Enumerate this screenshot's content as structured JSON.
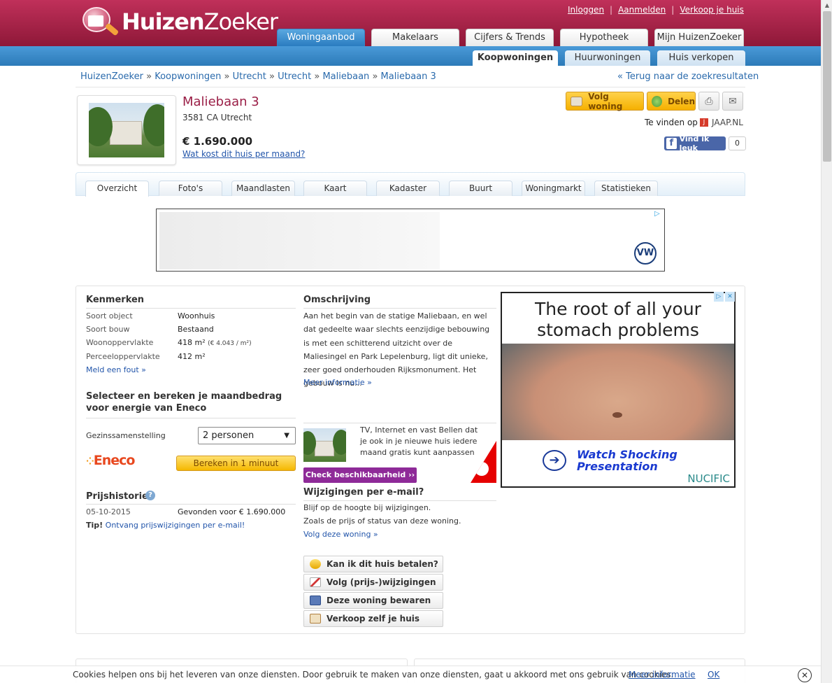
{
  "header": {
    "logo_bold": "Huizen",
    "logo_light": "Zoeker",
    "links": [
      "Inloggen",
      "Aanmelden",
      "Verkoop je huis"
    ],
    "main_tabs": [
      "Woningaanbod",
      "Makelaars",
      "Cijfers & Trends",
      "Hypotheek",
      "Mijn HuizenZoeker"
    ],
    "sub_tabs": [
      "Koopwoningen",
      "Huurwoningen",
      "Huis verkopen"
    ]
  },
  "breadcrumb": [
    "HuizenZoeker",
    "Koopwoningen",
    "Utrecht",
    "Utrecht",
    "Maliebaan",
    "Maliebaan 3"
  ],
  "breadcrumb_sep": "»",
  "back_link": "« Terug naar de zoekresultaten",
  "property": {
    "title": "Maliebaan 3",
    "address": "3581 CA Utrecht",
    "price": "€ 1.690.000",
    "cost_link": "Wat kost dit huis per maand?"
  },
  "actions": {
    "follow": "Volg woning",
    "share": "Delen",
    "print_icon": "printer-icon",
    "mail_icon": "envelope-icon",
    "found_on": "Te vinden op",
    "jaap": "JAAP.NL",
    "fb_like": "Vind ik leuk",
    "fb_count": "0"
  },
  "property_tabs": [
    "Overzicht",
    "Foto's",
    "Maandlasten",
    "Kaart",
    "Kadaster",
    "Buurt",
    "Woningmarkt",
    "Statistieken"
  ],
  "kenmerken": {
    "title": "Kenmerken",
    "rows": [
      {
        "label": "Soort object",
        "value": "Woonhuis"
      },
      {
        "label": "Soort bouw",
        "value": "Bestaand"
      },
      {
        "label": "Woonoppervlakte",
        "value": "418 m²",
        "extra": "(€ 4.043 / m²)"
      },
      {
        "label": "Perceeloppervlakte",
        "value": "412 m²"
      }
    ],
    "report_link": "Meld een fout »"
  },
  "energy": {
    "title_line1": "Selecteer en bereken je maandbedrag",
    "title_line2": "voor energie van Eneco",
    "household_label": "Gezinssamenstelling",
    "household_value": "2 personen",
    "logo": "Eneco",
    "calc_button": "Bereken in 1 minuut"
  },
  "price_history": {
    "title": "Prijshistorie",
    "date": "05-10-2015",
    "event": "Gevonden voor € 1.690.000",
    "tip_label": "Tip!",
    "tip_link": "Ontvang prijswijzigingen per e-mail!"
  },
  "description": {
    "title": "Omschrijving",
    "text": "Aan het begin van de statige Maliebaan, en wel dat gedeelte waar slechts eenzijdige bebouwing is met een schitterend uitzicht over de Maliesingel en Park Lepelenburg, ligt dit unieke, zeer goed onderhouden Rijksmonument. Het gebouw is nu...",
    "more": "Meer informatie »"
  },
  "vodafone": {
    "text": "TV, Internet en vast Bellen dat je ook in je nieuwe huis iedere maand gratis kunt aanpassen",
    "button": "Check beschikbaarheid ››"
  },
  "changes": {
    "title": "Wijzigingen per e-mail?",
    "line1": "Blijf op de hoogte bij wijzigingen.",
    "line2": "Zoals de prijs of status van deze woning.",
    "link": "Volg deze woning »"
  },
  "action_buttons": [
    "Kan ik dit huis betalen?",
    "Volg (prijs-)wijzigingen",
    "Deze woning bewaren",
    "Verkoop zelf je huis"
  ],
  "ad_right": {
    "headline": "The root of all your stomach problems",
    "cta": "Watch Shocking Presentation",
    "brand": "NUCIFIC"
  },
  "ad_top": {
    "brand": "VW"
  },
  "cookie": {
    "text": "Cookies helpen ons bij het leveren van onze diensten. Door gebruik te maken van onze diensten, gaat u akkoord met ons gebruik van cookies.",
    "more": "Meer informatie",
    "ok": "OK"
  },
  "colors": {
    "brand": "#a8234a",
    "nav_blue": "#2c7ab8",
    "button_yellow": "#f5b000",
    "vodafone_purple": "#8e2a98"
  }
}
